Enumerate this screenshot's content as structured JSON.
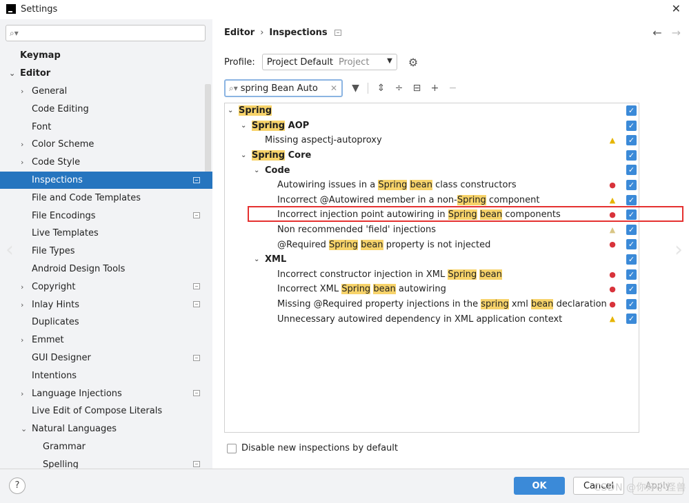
{
  "window": {
    "title": "Settings",
    "close_icon": "close-icon",
    "logo_icon": "intellij-logo-icon"
  },
  "sidebar": {
    "search": {
      "value": "",
      "icon": "search-icon"
    },
    "items": [
      {
        "label": "Keymap",
        "bold": true,
        "indent": 29,
        "arrow": "",
        "badge": false,
        "selected": false
      },
      {
        "label": "Editor",
        "bold": true,
        "indent": 29,
        "arrow": "down",
        "badge": false,
        "selected": false
      },
      {
        "label": "General",
        "bold": false,
        "indent": 46,
        "arrow": "right",
        "badge": false,
        "selected": false
      },
      {
        "label": "Code Editing",
        "bold": false,
        "indent": 46,
        "arrow": "",
        "badge": false,
        "selected": false
      },
      {
        "label": "Font",
        "bold": false,
        "indent": 46,
        "arrow": "",
        "badge": false,
        "selected": false
      },
      {
        "label": "Color Scheme",
        "bold": false,
        "indent": 46,
        "arrow": "right",
        "badge": false,
        "selected": false
      },
      {
        "label": "Code Style",
        "bold": false,
        "indent": 46,
        "arrow": "right",
        "badge": false,
        "selected": false
      },
      {
        "label": "Inspections",
        "bold": false,
        "indent": 46,
        "arrow": "",
        "badge": true,
        "selected": true
      },
      {
        "label": "File and Code Templates",
        "bold": false,
        "indent": 46,
        "arrow": "",
        "badge": false,
        "selected": false
      },
      {
        "label": "File Encodings",
        "bold": false,
        "indent": 46,
        "arrow": "",
        "badge": true,
        "selected": false
      },
      {
        "label": "Live Templates",
        "bold": false,
        "indent": 46,
        "arrow": "",
        "badge": false,
        "selected": false
      },
      {
        "label": "File Types",
        "bold": false,
        "indent": 46,
        "arrow": "",
        "badge": false,
        "selected": false
      },
      {
        "label": "Android Design Tools",
        "bold": false,
        "indent": 46,
        "arrow": "",
        "badge": false,
        "selected": false
      },
      {
        "label": "Copyright",
        "bold": false,
        "indent": 46,
        "arrow": "right",
        "badge": true,
        "selected": false
      },
      {
        "label": "Inlay Hints",
        "bold": false,
        "indent": 46,
        "arrow": "right",
        "badge": true,
        "selected": false
      },
      {
        "label": "Duplicates",
        "bold": false,
        "indent": 46,
        "arrow": "",
        "badge": false,
        "selected": false
      },
      {
        "label": "Emmet",
        "bold": false,
        "indent": 46,
        "arrow": "right",
        "badge": false,
        "selected": false
      },
      {
        "label": "GUI Designer",
        "bold": false,
        "indent": 46,
        "arrow": "",
        "badge": true,
        "selected": false
      },
      {
        "label": "Intentions",
        "bold": false,
        "indent": 46,
        "arrow": "",
        "badge": false,
        "selected": false
      },
      {
        "label": "Language Injections",
        "bold": false,
        "indent": 46,
        "arrow": "right",
        "badge": true,
        "selected": false
      },
      {
        "label": "Live Edit of Compose Literals",
        "bold": false,
        "indent": 46,
        "arrow": "",
        "badge": false,
        "selected": false
      },
      {
        "label": "Natural Languages",
        "bold": false,
        "indent": 46,
        "arrow": "down",
        "badge": false,
        "selected": false
      },
      {
        "label": "Grammar",
        "bold": false,
        "indent": 62,
        "arrow": "",
        "badge": false,
        "selected": false
      },
      {
        "label": "Spelling",
        "bold": false,
        "indent": 62,
        "arrow": "",
        "badge": true,
        "selected": false
      }
    ]
  },
  "header": {
    "breadcrumb": [
      "Editor",
      "Inspections"
    ],
    "separator": "›",
    "back_icon": "arrow-left-icon",
    "forward_icon": "arrow-right-icon"
  },
  "profile": {
    "label": "Profile:",
    "value": "Project Default",
    "hint": "Project",
    "settings_icon": "gear-icon"
  },
  "filter": {
    "value": "spring Bean Auto",
    "search_icon": "search-icon",
    "clear_icon": "clear-icon",
    "tools": [
      "filter-icon",
      "expand-all-icon",
      "collapse-all-icon",
      "reset-icon",
      "add-icon",
      "remove-icon"
    ]
  },
  "results": {
    "rows": [
      {
        "level": 0,
        "arrow": "down",
        "bold": true,
        "parts": [
          {
            "t": "Spring",
            "hl": true
          }
        ],
        "severity": "",
        "checked": true
      },
      {
        "level": 1,
        "arrow": "down",
        "bold": true,
        "parts": [
          {
            "t": "Spring",
            "hl": true
          },
          {
            "t": " AOP",
            "hl": false
          }
        ],
        "severity": "",
        "checked": true
      },
      {
        "level": 2,
        "arrow": "",
        "bold": false,
        "parts": [
          {
            "t": "Missing aspectj-autoproxy",
            "hl": false
          }
        ],
        "severity": "warning",
        "checked": true
      },
      {
        "level": 1,
        "arrow": "down",
        "bold": true,
        "parts": [
          {
            "t": "Spring",
            "hl": true
          },
          {
            "t": " Core",
            "hl": false
          }
        ],
        "severity": "",
        "checked": true
      },
      {
        "level": 2,
        "arrow": "down",
        "bold": true,
        "parts": [
          {
            "t": "Code",
            "hl": false
          }
        ],
        "severity": "",
        "checked": true
      },
      {
        "level": 3,
        "arrow": "",
        "bold": false,
        "parts": [
          {
            "t": "Autowiring issues in a ",
            "hl": false
          },
          {
            "t": "Spring",
            "hl": true
          },
          {
            "t": " ",
            "hl": false
          },
          {
            "t": "bean",
            "hl": true
          },
          {
            "t": " class constructors",
            "hl": false
          }
        ],
        "severity": "error",
        "checked": true
      },
      {
        "level": 3,
        "arrow": "",
        "bold": false,
        "parts": [
          {
            "t": "Incorrect @Autowired member in a non-",
            "hl": false
          },
          {
            "t": "Spring",
            "hl": true
          },
          {
            "t": " component",
            "hl": false
          }
        ],
        "severity": "warning",
        "checked": true
      },
      {
        "level": 3,
        "arrow": "",
        "bold": false,
        "parts": [
          {
            "t": "Incorrect injection point autowiring in ",
            "hl": false
          },
          {
            "t": "Spring",
            "hl": true
          },
          {
            "t": " ",
            "hl": false
          },
          {
            "t": "bean",
            "hl": true
          },
          {
            "t": " components",
            "hl": false
          }
        ],
        "severity": "error",
        "checked": true
      },
      {
        "level": 3,
        "arrow": "",
        "bold": false,
        "parts": [
          {
            "t": "Non recommended 'field' injections",
            "hl": false
          }
        ],
        "severity": "weak",
        "checked": true
      },
      {
        "level": 3,
        "arrow": "",
        "bold": false,
        "parts": [
          {
            "t": "@Required ",
            "hl": false
          },
          {
            "t": "Spring",
            "hl": true
          },
          {
            "t": " ",
            "hl": false
          },
          {
            "t": "bean",
            "hl": true
          },
          {
            "t": " property is not injected",
            "hl": false
          }
        ],
        "severity": "error",
        "checked": true
      },
      {
        "level": 2,
        "arrow": "down",
        "bold": true,
        "parts": [
          {
            "t": "XML",
            "hl": false
          }
        ],
        "severity": "",
        "checked": true
      },
      {
        "level": 3,
        "arrow": "",
        "bold": false,
        "parts": [
          {
            "t": "Incorrect constructor injection in XML ",
            "hl": false
          },
          {
            "t": "Spring",
            "hl": true
          },
          {
            "t": " ",
            "hl": false
          },
          {
            "t": "bean",
            "hl": true
          }
        ],
        "severity": "error",
        "checked": true
      },
      {
        "level": 3,
        "arrow": "",
        "bold": false,
        "parts": [
          {
            "t": "Incorrect XML ",
            "hl": false
          },
          {
            "t": "Spring",
            "hl": true
          },
          {
            "t": " ",
            "hl": false
          },
          {
            "t": "bean",
            "hl": true
          },
          {
            "t": " autowiring",
            "hl": false
          }
        ],
        "severity": "error",
        "checked": true
      },
      {
        "level": 3,
        "arrow": "",
        "bold": false,
        "parts": [
          {
            "t": "Missing @Required property injections in the ",
            "hl": false
          },
          {
            "t": "spring",
            "hl": true
          },
          {
            "t": " xml ",
            "hl": false
          },
          {
            "t": "bean",
            "hl": true
          },
          {
            "t": " declaration",
            "hl": false
          }
        ],
        "severity": "error",
        "checked": true
      },
      {
        "level": 3,
        "arrow": "",
        "bold": false,
        "parts": [
          {
            "t": "Unnecessary autowired dependency in XML application context",
            "hl": false
          }
        ],
        "severity": "warning",
        "checked": true
      }
    ],
    "highlighted_row": 7
  },
  "options": {
    "disable_new_label": "Disable new inspections by default",
    "disable_new_checked": false
  },
  "footer": {
    "help_label": "?",
    "ok_label": "OK",
    "cancel_label": "Cancel",
    "apply_label": "Apply",
    "watermark": "CSDN @你好小怪兽"
  },
  "colors": {
    "selection": "#2675bf",
    "highlight": "#f7d36a",
    "primary": "#3b8ad8",
    "error": "#d8333b",
    "warning": "#e6b400",
    "annotation": "#e5302f"
  }
}
